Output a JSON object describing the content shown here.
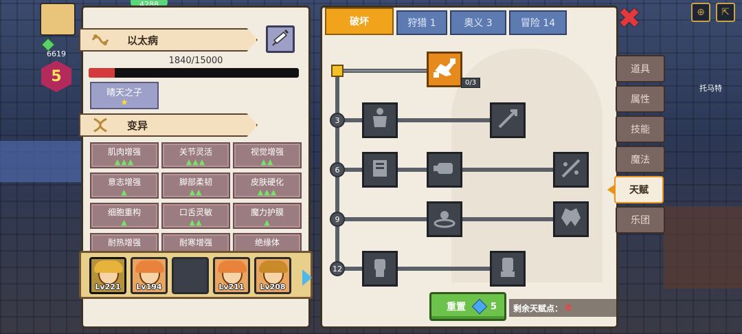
{
  "hud": {
    "gem_count": "6619",
    "level": "5",
    "top_pill": "4288",
    "npc_name": "托马特"
  },
  "left_panel": {
    "disease_title": "以太病",
    "progress_text": "1840/15000",
    "progress_fraction": 0.1227,
    "trait_name": "晴天之子",
    "trait_stars": "★",
    "mutation_title": "变异",
    "mutations": [
      {
        "name": "肌肉增强",
        "level": "▲▲▲"
      },
      {
        "name": "关节灵活",
        "level": "▲▲▲"
      },
      {
        "name": "视觉增强",
        "level": "▲▲"
      },
      {
        "name": "意志增强",
        "level": "▲"
      },
      {
        "name": "脚部柔韧",
        "level": "▲▲"
      },
      {
        "name": "皮肤硬化",
        "level": "▲▲▲"
      },
      {
        "name": "细胞重构",
        "level": "▲"
      },
      {
        "name": "口舌灵敏",
        "level": "▲▲"
      },
      {
        "name": "魔力护膜",
        "level": "▲"
      },
      {
        "name": "耐热增强",
        "level": ""
      },
      {
        "name": "耐寒增强",
        "level": ""
      },
      {
        "name": "绝缘体",
        "level": ""
      }
    ],
    "heroes": [
      {
        "level": "Lv221",
        "hair": "#e6b43a",
        "selected": true
      },
      {
        "level": "Lv194",
        "hair": "#e9823a",
        "selected": false
      },
      {
        "level": "",
        "hair": "",
        "selected": false
      },
      {
        "level": "Lv211",
        "hair": "#e9823a",
        "selected": false
      },
      {
        "level": "Lv208",
        "hair": "#c98a2a",
        "selected": false
      }
    ]
  },
  "talent_panel": {
    "tabs": [
      {
        "label": "破坏",
        "active": true
      },
      {
        "label": "狩猎 1",
        "active": false
      },
      {
        "label": "奥义 3",
        "active": false
      },
      {
        "label": "冒险 14",
        "active": false
      }
    ],
    "top_node_count": "0/3",
    "row_levels": [
      "3",
      "6",
      "9",
      "12"
    ],
    "reset_label": "重置",
    "reset_cost": "5",
    "remaining_label": "剩余天赋点：",
    "remaining_points": "0"
  },
  "side_menu": {
    "items": [
      {
        "label": "道具",
        "active": false
      },
      {
        "label": "属性",
        "active": false
      },
      {
        "label": "技能",
        "active": false
      },
      {
        "label": "魔法",
        "active": false
      },
      {
        "label": "天赋",
        "active": true
      },
      {
        "label": "乐团",
        "active": false
      }
    ]
  },
  "colors": {
    "accent_orange": "#f2a31c",
    "tab_blue": "#5d7bb0",
    "progress_red": "#d43a3a",
    "reset_green": "#6cc24a"
  }
}
